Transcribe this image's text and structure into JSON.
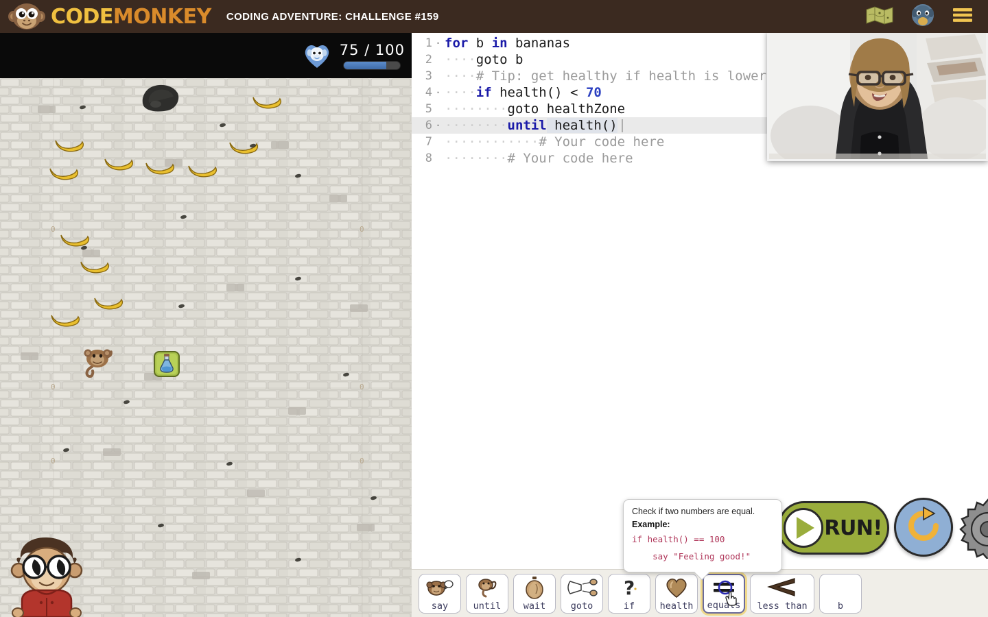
{
  "topbar": {
    "logo_text_1": "CODE",
    "logo_text_2": "MONKEY",
    "logo_full": "CodeMonkey",
    "challenge_title": "CODING ADVENTURE: CHALLENGE #159",
    "icons": [
      {
        "name": "map-icon",
        "label": "Map"
      },
      {
        "name": "avatar-icon",
        "label": "Profile"
      },
      {
        "name": "hamburger-menu-icon",
        "label": "Menu"
      }
    ],
    "bg_color": "#3b2a20",
    "logo_color": "#f0c040"
  },
  "game": {
    "hud": {
      "health_icon": "heart-monkey-icon",
      "score_current": "75",
      "score_separator": "/",
      "score_max": "100",
      "score_text": "75 / 100",
      "bar_percent": 75,
      "bar_color": "#4a77b8"
    },
    "grid_labels": [
      "0",
      "0",
      "0",
      "0",
      "0",
      "0"
    ],
    "sprites": {
      "player": "monkey-sprite",
      "collectible": "banana",
      "obstacle": "rock",
      "health_zone": "potion-tile",
      "avatar": "monkey-avatar-glasses"
    },
    "banana_count": 11,
    "background": "stone-wall"
  },
  "editor": {
    "lines": [
      {
        "number": "1",
        "foldable": true,
        "active": false,
        "tokens": [
          {
            "t": "for",
            "c": "kw"
          },
          {
            "t": " b ",
            "c": "plain"
          },
          {
            "t": "in",
            "c": "kw"
          },
          {
            "t": " bananas",
            "c": "plain"
          }
        ],
        "text": "for b in bananas"
      },
      {
        "number": "2",
        "foldable": false,
        "active": false,
        "tokens": [
          {
            "t": "····",
            "c": "indent-dots"
          },
          {
            "t": "goto b",
            "c": "plain"
          }
        ],
        "text": "    goto b"
      },
      {
        "number": "3",
        "foldable": false,
        "active": false,
        "tokens": [
          {
            "t": "····",
            "c": "indent-dots"
          },
          {
            "t": "# Tip: get healthy if health is lower",
            "c": "cmt"
          }
        ],
        "text": "    # Tip: get healthy if health is lower"
      },
      {
        "number": "4",
        "foldable": true,
        "active": false,
        "tokens": [
          {
            "t": "····",
            "c": "indent-dots"
          },
          {
            "t": "if",
            "c": "kw"
          },
          {
            "t": " health() < ",
            "c": "plain"
          },
          {
            "t": "70",
            "c": "num"
          }
        ],
        "text": "    if health() < 70"
      },
      {
        "number": "5",
        "foldable": false,
        "active": false,
        "tokens": [
          {
            "t": "········",
            "c": "indent-dots"
          },
          {
            "t": "goto healthZone",
            "c": "plain"
          }
        ],
        "text": "        goto healthZone"
      },
      {
        "number": "6",
        "foldable": true,
        "active": true,
        "tokens": [
          {
            "t": "········",
            "c": "indent-dots"
          },
          {
            "t": "until",
            "c": "kw"
          },
          {
            "t": " health()",
            "c": "plain sel-token"
          }
        ],
        "text": "        until health()"
      },
      {
        "number": "7",
        "foldable": false,
        "active": false,
        "tokens": [
          {
            "t": "············",
            "c": "indent-dots"
          },
          {
            "t": "# Your code here",
            "c": "cmt"
          }
        ],
        "text": "            # Your code here"
      },
      {
        "number": "8",
        "foldable": false,
        "active": false,
        "tokens": [
          {
            "t": "········",
            "c": "indent-dots"
          },
          {
            "t": "# Your code here",
            "c": "cmt"
          }
        ],
        "text": "        # Your code here"
      }
    ],
    "cursor_line": "6",
    "colors": {
      "keyword": "#1a1aa8",
      "number": "#2b3fc0",
      "comment": "#9b9b9b",
      "text": "#1a1a1a"
    }
  },
  "tooltip": {
    "description": "Check if two numbers are equal.",
    "example_label": "Example:",
    "code_line_1": "if health() == 100",
    "code_line_2": "    say \"Feeling good!\"",
    "code_color": "#b0375a"
  },
  "controls": {
    "run_label": "RUN!",
    "run_icon": "play-icon",
    "run_color": "#9aad3c",
    "reset_icon": "refresh-icon",
    "reset_color": "#8fafd4",
    "settings_icon": "gear-icon"
  },
  "blocks": [
    {
      "label": "say",
      "icon": "monkey-speech-icon",
      "hovered": false,
      "wide": false
    },
    {
      "label": "until",
      "icon": "monkey-loop-icon",
      "hovered": false,
      "wide": false
    },
    {
      "label": "wait",
      "icon": "clock-icon",
      "hovered": false,
      "wide": false
    },
    {
      "label": "goto",
      "icon": "goto-arrow-icon",
      "hovered": false,
      "wide": false
    },
    {
      "label": "if",
      "icon": "question-mark-icon",
      "hovered": false,
      "wide": false
    },
    {
      "label": "health",
      "icon": "heart-icon",
      "hovered": false,
      "wide": false
    },
    {
      "label": "equals",
      "icon": "equals-icon",
      "hovered": true,
      "wide": false
    },
    {
      "label": "less than",
      "icon": "less-than-icon",
      "hovered": false,
      "wide": true
    },
    {
      "label": "b",
      "icon": "variable-icon",
      "hovered": false,
      "wide": false
    }
  ],
  "video": {
    "label": "instructor-webcam",
    "visible": true
  }
}
